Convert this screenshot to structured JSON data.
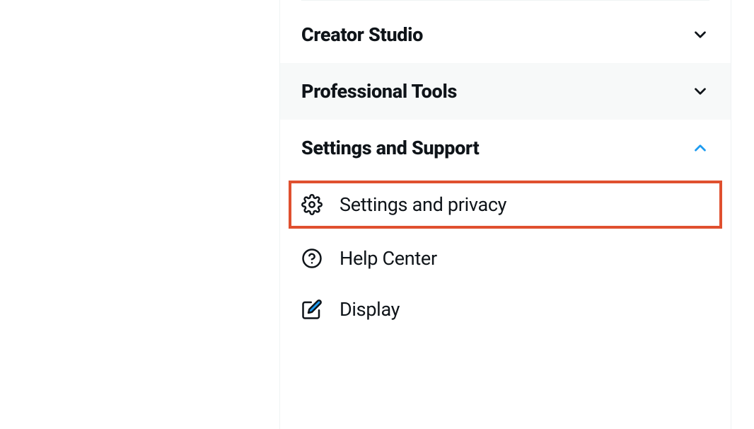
{
  "sections": {
    "creator_studio": {
      "label": "Creator Studio",
      "expanded": false
    },
    "professional_tools": {
      "label": "Professional Tools",
      "expanded": false
    },
    "settings_support": {
      "label": "Settings and Support",
      "expanded": true
    }
  },
  "menu_items": {
    "settings_privacy": {
      "label": "Settings and privacy",
      "highlighted": true,
      "icon": "gear"
    },
    "help_center": {
      "label": "Help Center",
      "highlighted": false,
      "icon": "question"
    },
    "display": {
      "label": "Display",
      "highlighted": false,
      "icon": "edit"
    }
  },
  "colors": {
    "highlight_border": "#e0502f",
    "expanded_chevron": "#1d9bf0",
    "text": "#0f1419",
    "hover_bg": "#f7f9f9"
  }
}
